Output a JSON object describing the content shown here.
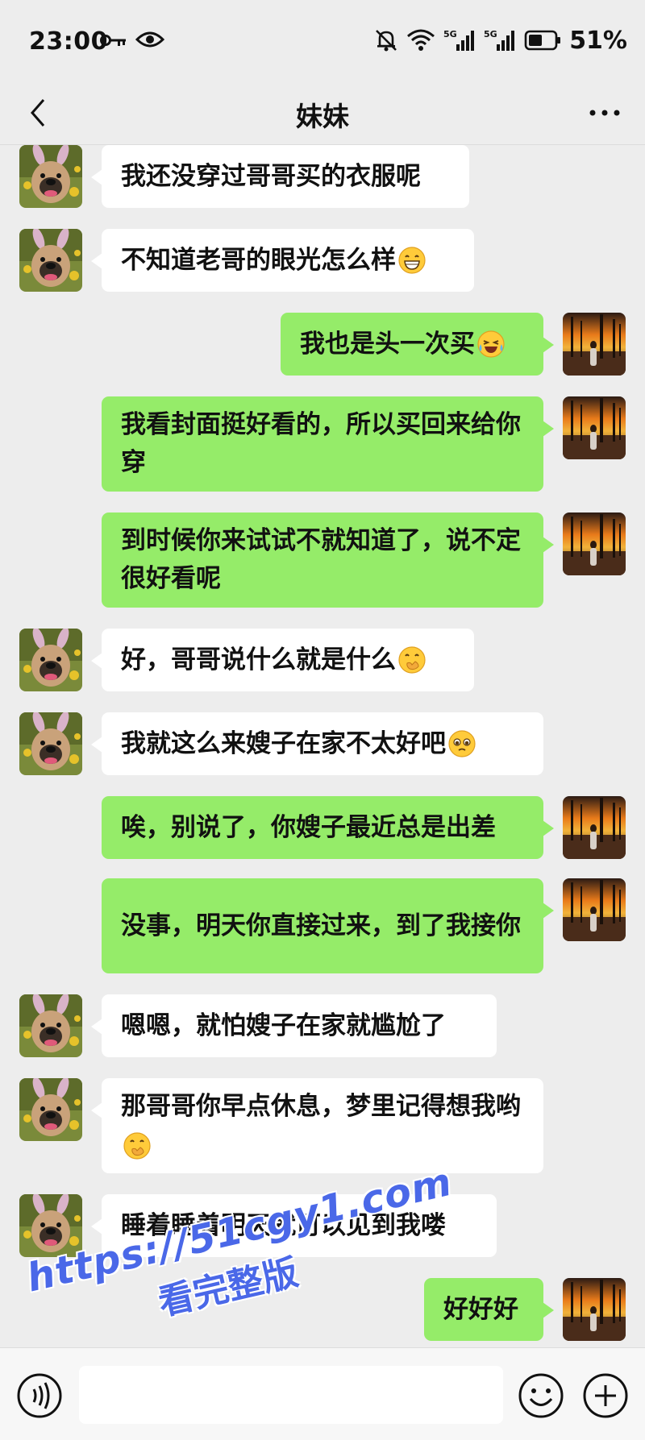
{
  "status_bar": {
    "time": "23:00",
    "network_1": "5G",
    "network_2": "5G",
    "battery": "51%"
  },
  "header": {
    "title": "妹妹",
    "back_icon": "chevron-left-icon",
    "more_icon": "more-dots-icon"
  },
  "messages": [
    {
      "side": "left",
      "text": "我还没穿过哥哥买的衣服呢"
    },
    {
      "side": "left",
      "text": "不知道老哥的眼光怎么样",
      "emoji": "grinning-emoji"
    },
    {
      "side": "right",
      "text": "我也是头一次买",
      "emoji": "laugh-cry-emoji"
    },
    {
      "side": "right",
      "text": "我看封面挺好看的，所以买回来给你穿"
    },
    {
      "side": "right",
      "text": "到时候你来试试不就知道了，说不定很好看呢"
    },
    {
      "side": "left",
      "text": "好，哥哥说什么就是什么",
      "emoji": "hand-over-mouth-emoji"
    },
    {
      "side": "left",
      "text": "我就这么来嫂子在家不太好吧",
      "emoji": "pleading-emoji"
    },
    {
      "side": "right",
      "text": "唉，别说了，你嫂子最近总是出差"
    },
    {
      "side": "right",
      "text": "没事，明天你直接过来，到了我接你"
    },
    {
      "side": "left",
      "text": "嗯嗯，就怕嫂子在家就尴尬了"
    },
    {
      "side": "left",
      "text": "那哥哥你早点休息，梦里记得想我哟",
      "emoji": "hand-over-mouth-emoji"
    },
    {
      "side": "left",
      "text": "睡着睡着明天就可以见到我喽"
    },
    {
      "side": "right",
      "text": "好好好"
    }
  ],
  "watermark": {
    "line1": "https://51cgy1.com",
    "line2": "看完整版"
  },
  "colors": {
    "background": "#ededed",
    "bubble_self": "#95ec69",
    "bubble_other": "#ffffff"
  }
}
